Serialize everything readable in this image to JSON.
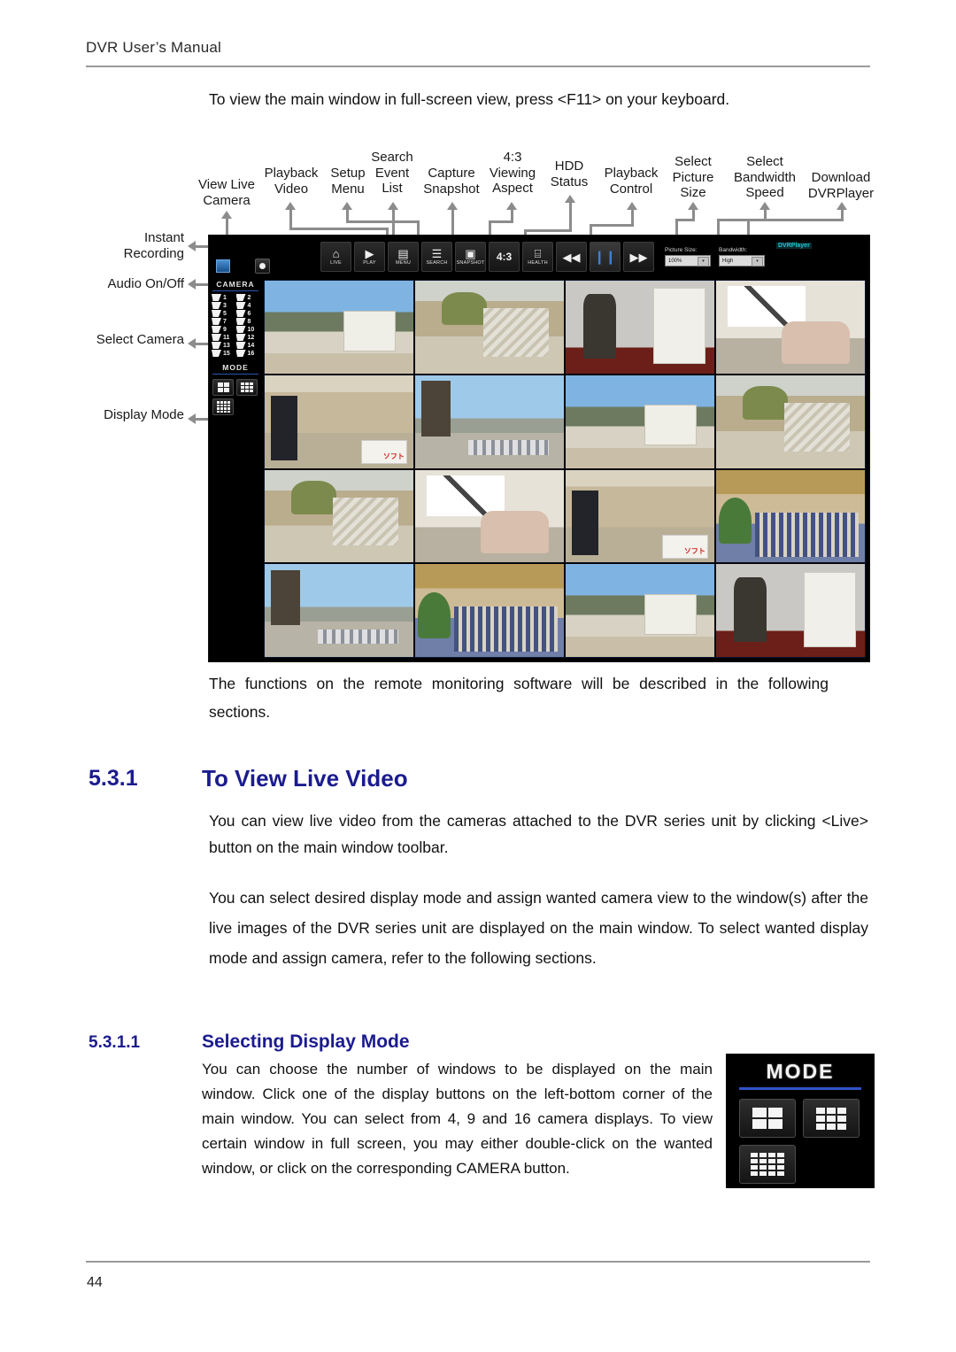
{
  "header": {
    "title": "DVR User’s Manual"
  },
  "footer": {
    "page_number": "44"
  },
  "body": {
    "intro_line": "To view the main window in full-screen view, press <F11> on your keyboard.",
    "after_figure": "The functions on the remote monitoring software will be described in the following sections.",
    "live_para_1": "You can view live video from the cameras attached to the DVR series unit by clicking <Live> button on the main window toolbar.",
    "live_para_2": "You can select desired display mode and assign wanted camera view to the window(s) after the live images of the DVR series unit are displayed on the main window. To select wanted display mode and assign camera, refer to the following sections.",
    "mode_para": "You can choose the number of windows to be displayed on the main window. Click one of the display buttons on the left-bottom corner of the main window. You can select from 4, 9 and 16 camera displays. To view certain window in full screen, you may either double-click on the wanted window, or click on the corresponding CAMERA button."
  },
  "headings": {
    "h2_number": "5.3.1",
    "h2_text": "To View Live Video",
    "h3_number": "5.3.1.1",
    "h3_text": "Selecting Display Mode",
    "color": "#1b1b8f"
  },
  "figure": {
    "callouts_top": [
      {
        "label": "View Live\nCamera"
      },
      {
        "label": "Playback\nVideo"
      },
      {
        "label": "Setup\nMenu"
      },
      {
        "label": "Search\nEvent\nList"
      },
      {
        "label": "Capture\nSnapshot"
      },
      {
        "label": "4:3\nViewing\nAspect"
      },
      {
        "label": "HDD\nStatus"
      },
      {
        "label": "Playback\nControl"
      },
      {
        "label": "Select\nPicture\nSize"
      },
      {
        "label": "Select\nBandwidth\nSpeed"
      },
      {
        "label": "Download\nDVRPlayer"
      }
    ],
    "callouts_left": [
      {
        "label": "Instant\nRecording"
      },
      {
        "label": "Audio On/Off"
      },
      {
        "label": "Select Camera"
      },
      {
        "label": "Display Mode"
      }
    ]
  },
  "dvr_app": {
    "toolbar_buttons": [
      {
        "caption": "LIVE",
        "icon": "live-camera-icon",
        "glyph": "⌂"
      },
      {
        "caption": "PLAY",
        "icon": "play-icon",
        "glyph": "▶"
      },
      {
        "caption": "MENU",
        "icon": "menu-icon",
        "glyph": "▤"
      },
      {
        "caption": "SEARCH",
        "icon": "search-icon",
        "glyph": "☰"
      },
      {
        "caption": "SNAPSHOT",
        "icon": "camera-snapshot-icon",
        "glyph": "▣"
      },
      {
        "caption": "",
        "icon": "aspect-ratio-icon",
        "glyph": "4:3"
      },
      {
        "caption": "HEALTH",
        "icon": "hdd-health-icon",
        "glyph": "⌸"
      },
      {
        "caption": "",
        "icon": "rewind-icon",
        "glyph": "◀◀"
      },
      {
        "caption": "",
        "icon": "pause-icon",
        "glyph": "❙❙"
      },
      {
        "caption": "",
        "icon": "fast-forward-icon",
        "glyph": "▶▶"
      }
    ],
    "picture_size": {
      "label": "Picture Size:",
      "value": "100%"
    },
    "bandwidth": {
      "label": "Bandwidth:",
      "value": "High"
    },
    "dvrplayer_link": "DVRPlayer",
    "camera_panel": {
      "title": "CAMERA",
      "cameras": [
        "1",
        "2",
        "3",
        "4",
        "5",
        "6",
        "7",
        "8",
        "9",
        "10",
        "11",
        "12",
        "13",
        "14",
        "15",
        "16"
      ]
    },
    "mode_panel": {
      "title": "MODE",
      "buttons": [
        "4-split-grid",
        "9-split-grid",
        "16-split-grid"
      ]
    },
    "accent_color": "#2b55b0",
    "link_color": "#19c6d6"
  },
  "mode_figure": {
    "title": "MODE",
    "buttons": [
      "4-split-grid",
      "9-split-grid",
      "16-split-grid"
    ],
    "rule_color": "#2f54c8"
  }
}
